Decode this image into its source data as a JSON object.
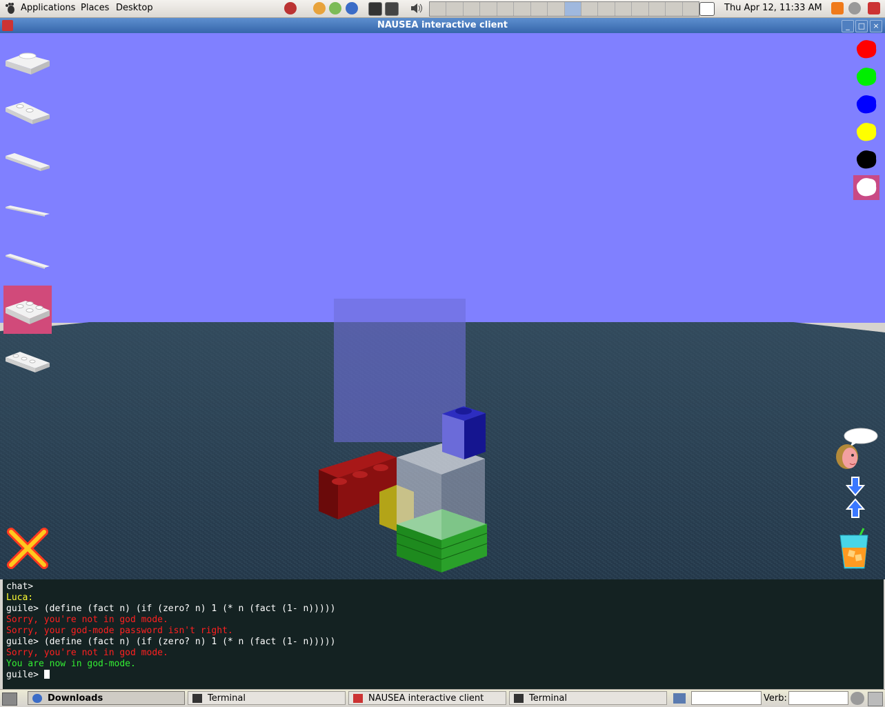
{
  "top_panel": {
    "menus": [
      "Applications",
      "Places",
      "Desktop"
    ],
    "clock": "Thu Apr 12, 11:33 AM"
  },
  "window": {
    "title": "NAUSEA interactive client"
  },
  "left_toolbar": {
    "brick_tools": [
      "brick-2x2-plate",
      "brick-2x3-plate",
      "brick-1x4-plate",
      "brick-1x6-plate",
      "brick-1x8-plate",
      "brick-2x3-plate-wide",
      "brick-2x4-plate"
    ],
    "selected_index": 5
  },
  "right_toolbar": {
    "colors": [
      "#ff0000",
      "#00ee00",
      "#0000ff",
      "#ffff00",
      "#000000",
      "#ffffff"
    ],
    "selected_index": 5
  },
  "console": {
    "lines": [
      {
        "text": "chat>",
        "color": "white"
      },
      {
        "text": "Luca:",
        "color": "yellow"
      },
      {
        "text": "guile> (define (fact n) (if (zero? n) 1 (* n (fact (1- n)))))",
        "color": "white"
      },
      {
        "text": "Sorry, you're not in god mode.",
        "color": "red"
      },
      {
        "text": "Sorry, your god-mode password isn't right.",
        "color": "red"
      },
      {
        "text": "guile> (define (fact n) (if (zero? n) 1 (* n (fact (1- n)))))",
        "color": "white"
      },
      {
        "text": "Sorry, you're not in god mode.",
        "color": "red"
      },
      {
        "text": "You are now in god-mode.",
        "color": "green"
      }
    ],
    "prompt": "guile> "
  },
  "taskbar": {
    "tasks": [
      "Downloads",
      "Terminal",
      "NAUSEA interactive client",
      "Terminal"
    ],
    "verb_label": "Verb:"
  }
}
